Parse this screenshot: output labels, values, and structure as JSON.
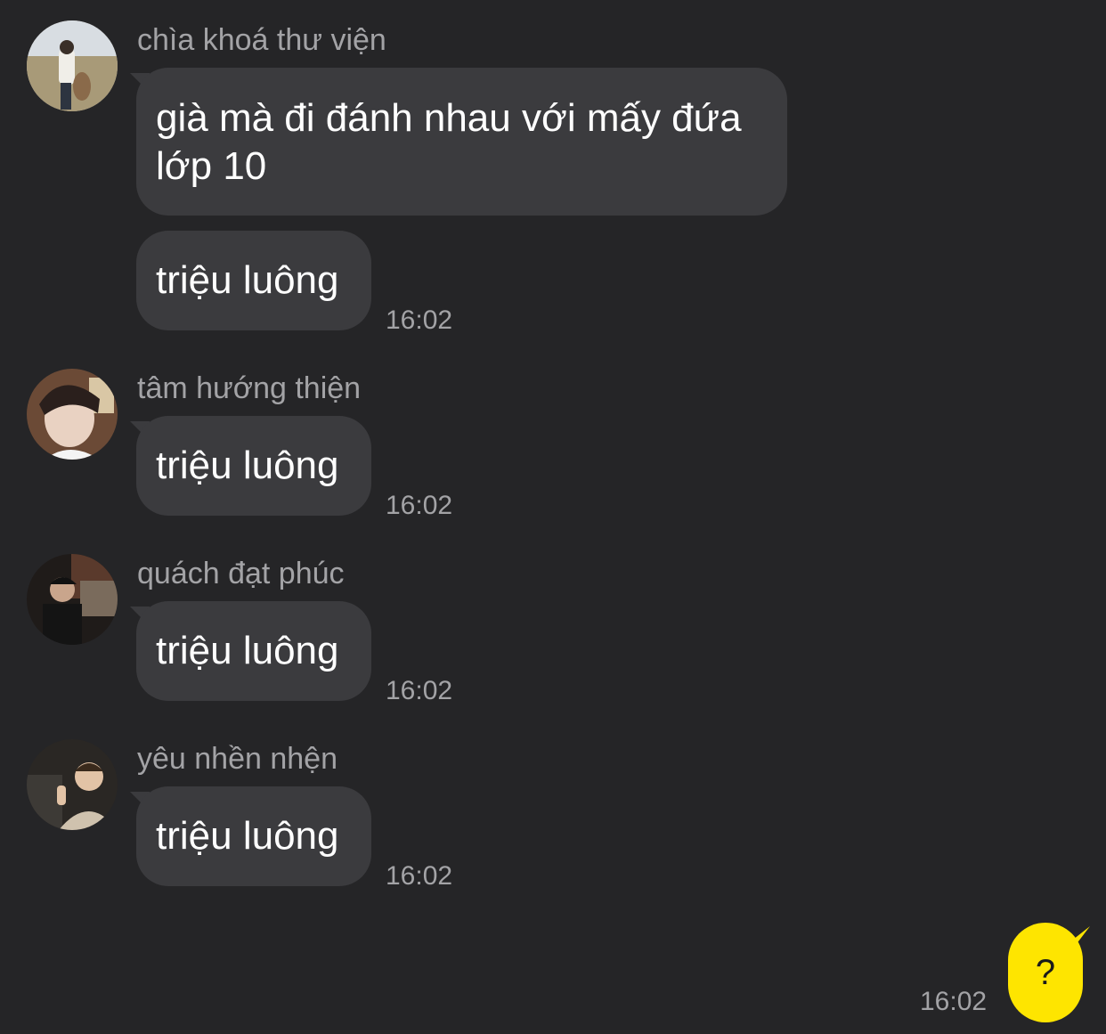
{
  "messages": [
    {
      "sender": "chìa khoá thư viện",
      "bubbles": [
        "già mà đi đánh nhau với mấy đứa lớp 10",
        "triệu luông"
      ],
      "time": "16:02"
    },
    {
      "sender": "tâm hướng thiện",
      "bubbles": [
        "triệu luông"
      ],
      "time": "16:02"
    },
    {
      "sender": "quách đạt phúc",
      "bubbles": [
        "triệu luông"
      ],
      "time": "16:02"
    },
    {
      "sender": "yêu nhền nhện",
      "bubbles": [
        "triệu luông"
      ],
      "time": "16:02"
    }
  ],
  "my_message": {
    "text": "?",
    "time": "16:02"
  },
  "colors": {
    "background": "#252527",
    "incoming_bubble": "#3b3b3e",
    "outgoing_bubble": "#fee500",
    "meta_text": "#a3a3a6"
  }
}
